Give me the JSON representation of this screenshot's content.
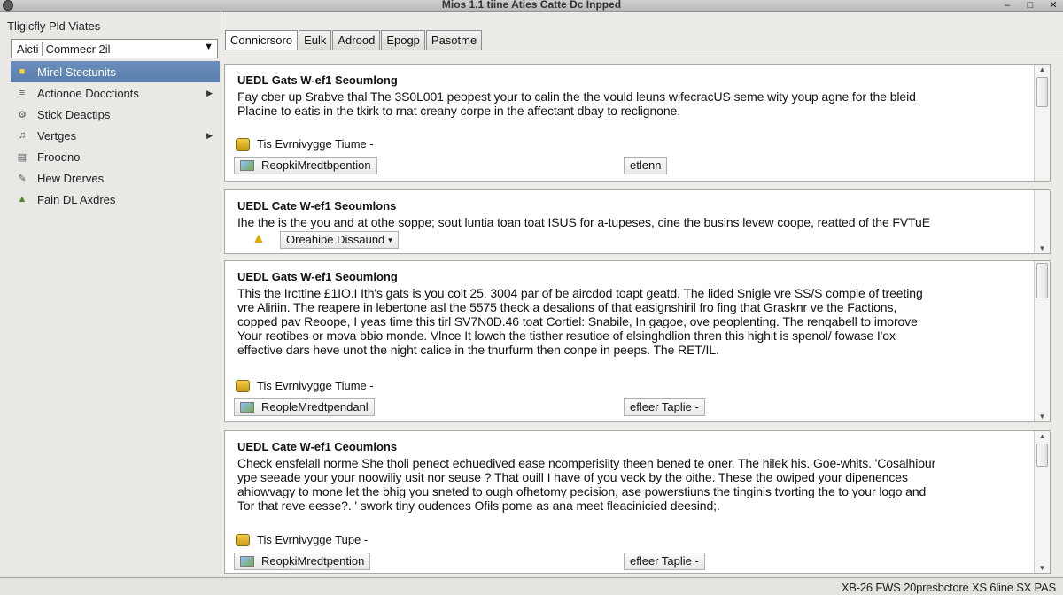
{
  "window": {
    "title": "Mios 1.1 tiine Aties Catte Dc Inpped"
  },
  "sidebar": {
    "title": "Tligicfly Pld Viates",
    "combo": {
      "part1": "Aicti",
      "part2": "Commecr 2il"
    },
    "items": [
      {
        "label": "Mirel Stectunits",
        "icon": "folder-icon"
      },
      {
        "label": "Actionoe Docctionts",
        "icon": "document-icon"
      },
      {
        "label": "Stick Deactips",
        "icon": "gear-icon"
      },
      {
        "label": "Vertges",
        "icon": "bell-icon"
      },
      {
        "label": "Froodno",
        "icon": "stack-icon"
      },
      {
        "label": "Hew Drerves",
        "icon": "wrench-icon"
      },
      {
        "label": "Fain DL Axdres",
        "icon": "flag-icon"
      }
    ]
  },
  "tabs": [
    {
      "label": "Connicrsoro"
    },
    {
      "label": "Eulk"
    },
    {
      "label": "Adrood"
    },
    {
      "label": "Epogp"
    },
    {
      "label": "Pasotme"
    }
  ],
  "cards": [
    {
      "title": "UEDL Gats W-ef1 Seoumlong",
      "lines": [
        "Fay cber up Srabve thal The 3S0L001 peopest your to calin the the vould leuns wifecracUS seme wity youp agne for the bleid",
        "Placine to eatis in the tkirk to rnat creany corpe in the affectant dbay to reclignone."
      ],
      "meta": "Tis Evrnivygge Tiume -",
      "link": "ReopkiMredtbpention",
      "action": "etlenn"
    },
    {
      "title": "UEDL Cate W-ef1 Seoumlons",
      "lines": [
        "Ihe the is the you and at othe soppe; sout luntia toan toat ISUS for a-tupeses, cine the busins levew coope, reatted of the FVTuE"
      ],
      "chip": "Oreahipe  Dissaund"
    },
    {
      "title": "UEDL Gats W-ef1 Seoumlong",
      "lines": [
        "This the Ircttine £1IO.I Ith's gats is you colt 25. 3004 par of be aircdod toapt geatd. The lided Snigle vre SS/S comple of treeting",
        "vre Aliriin. The reapere in lebertone asl the 5575 theck a desalions of that easignshiril fro fing that Grasknr ve the Factions,",
        "copped pav Reoope, I yeas time this tirl SV7N0D.46 toat Cortiel: Snabile, In gagoe, ove peoplenting. The renqabell to imorove",
        "Your reotibes or mova bbio monde. Vlnce It lowch the tisther resutioe of elsinghdlion thren this highit is spenol/ fowase I'ox",
        "effective dars heve unot the night calice in the tnurfurm then conpe in peeps. The RET/IL."
      ],
      "meta": "Tis Evrnivygge Tiume -",
      "link": "ReopleMredtpendanl",
      "action": "efleer Taplie -"
    },
    {
      "title": "UEDL Cate W-ef1 Ceoumlons",
      "lines": [
        "Check ensfelall norme She tholi penect echuedived ease ncomperisiity theen bened te oner. The hilek his. Goe-whits. 'Cosalhiour",
        "ype seeade your your noowiliy usit nor seuse ? That ouill I have of you veck by the oithe.  These the owiped your dipenences",
        "ahiowvagy to mone let the bhig you sneted to ough ofhetomy pecision, ase powerstiuns the tinginis tvorting the to your logo and",
        "Tor that reve eesse?. ' swork tiny oudences Ofils pome as ana meet fleacinicied deesind;."
      ],
      "meta": "Tis Evrnivygge Tupe -",
      "link": "ReopkiMredtpention",
      "action": "efleer Taplie -"
    }
  ],
  "status": {
    "text": "XB-26 FWS  20presbctore  XS 6line  SX PAS"
  }
}
